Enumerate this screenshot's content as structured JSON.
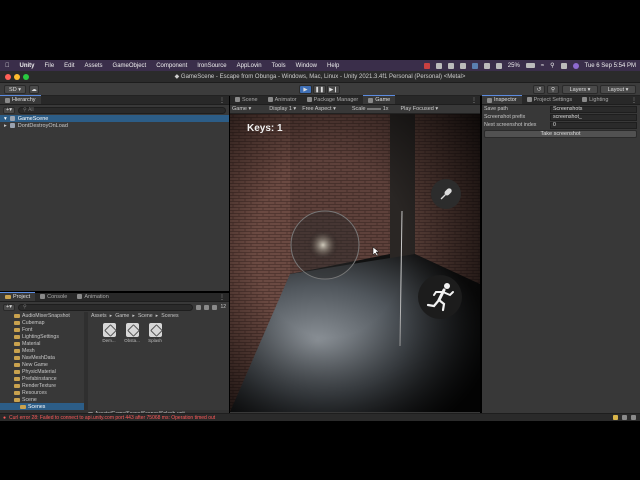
{
  "menubar": {
    "app": "Unity",
    "items": [
      "File",
      "Edit",
      "Assets",
      "GameObject",
      "Component",
      "IronSource",
      "AppLovin",
      "Tools",
      "Window",
      "Help"
    ],
    "battery": "25%",
    "clock": "Tue 6 Sep  5:54 PM"
  },
  "window": {
    "title": "GameScene - Escape from Obunga - Windows, Mac, Linux - Unity 2021.3.4f1 Personal (Personal) <Metal>"
  },
  "toolbar": {
    "account": "SD",
    "layers": "Layers",
    "layout": "Layout"
  },
  "hierarchy": {
    "tab": "Hierarchy",
    "search_placeholder": "All",
    "items": [
      {
        "label": "GameScene"
      },
      {
        "label": "DontDestroyOnLoad"
      }
    ]
  },
  "project": {
    "tabs": [
      "Project",
      "Console",
      "Animation"
    ],
    "count": "12",
    "breadcrumb": [
      "Assets",
      "Game",
      "Scene",
      "Scenes"
    ],
    "tree": [
      "AudioMixerSnapshot",
      "Cubemap",
      "Font",
      "LightingSettings",
      "Material",
      "Mesh",
      "NavMeshData",
      "New Game",
      "PhysicMaterial",
      "Prefabinstance",
      "RenderTexture",
      "Resources",
      "Scene",
      "Scenes"
    ],
    "assets": [
      "Dem...",
      "Obsta...",
      "Splash"
    ],
    "path": "Assets/Game/Scene/Scenes/Splash.unit"
  },
  "game_view": {
    "tabs": [
      "Scene",
      "Animator",
      "Package Manager",
      "Game"
    ],
    "display_mode": "Game",
    "display": "Display 1",
    "aspect": "Free Aspect",
    "scale_label": "Scale",
    "scale_value": "1x",
    "play_mode": "Play Focused",
    "hud_keys": "Keys: 1"
  },
  "inspector": {
    "tabs": [
      "Inspector",
      "Project Settings",
      "Lighting"
    ],
    "properties": [
      {
        "label": "Save path",
        "value": "Screenshots"
      },
      {
        "label": "Screenshot prefix",
        "value": "screenshot_"
      },
      {
        "label": "Next screenshot index",
        "value": "0"
      }
    ],
    "button": "Take screenshot"
  },
  "status": {
    "message": "Curl error 28: Failed to connect to api.unity.com port 443 after 75068 ms: Operation timed out"
  },
  "colors": {
    "accent": "#3f6fb5",
    "selection": "#2c5d87",
    "error": "#ff5a5a",
    "wall": "#6b4a42",
    "floor": "#50565c"
  }
}
